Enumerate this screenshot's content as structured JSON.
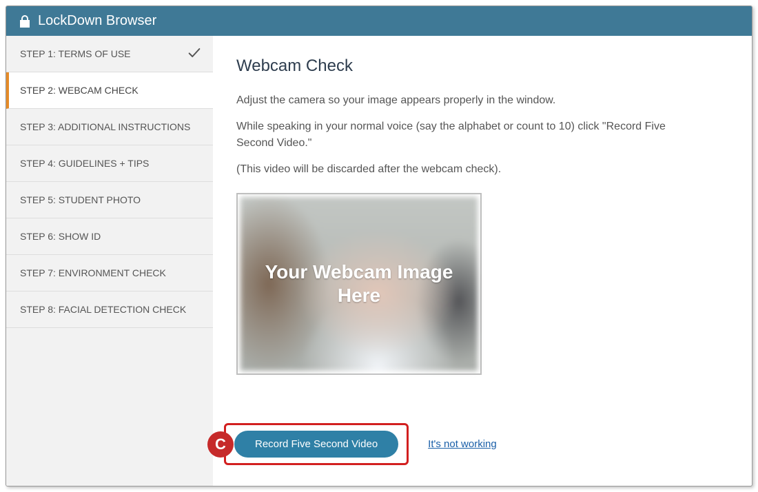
{
  "app_title": "LockDown Browser",
  "sidebar": {
    "steps": [
      {
        "label": "STEP 1: TERMS OF USE",
        "completed": true,
        "active": false
      },
      {
        "label": "STEP 2: WEBCAM CHECK",
        "completed": false,
        "active": true
      },
      {
        "label": "STEP 3: ADDITIONAL INSTRUCTIONS",
        "completed": false,
        "active": false
      },
      {
        "label": "STEP 4: GUIDELINES + TIPS",
        "completed": false,
        "active": false
      },
      {
        "label": "STEP 5: STUDENT PHOTO",
        "completed": false,
        "active": false
      },
      {
        "label": "STEP 6: SHOW ID",
        "completed": false,
        "active": false
      },
      {
        "label": "STEP 7: ENVIRONMENT CHECK",
        "completed": false,
        "active": false
      },
      {
        "label": "STEP 8: FACIAL DETECTION CHECK",
        "completed": false,
        "active": false
      }
    ]
  },
  "main": {
    "title": "Webcam Check",
    "paragraph1": "Adjust the camera so your image appears properly in the window.",
    "paragraph2": "While speaking in your normal voice (say the alphabet or count to 10) click \"Record Five Second Video.\"",
    "paragraph3": "(This video will be discarded after the webcam check).",
    "webcam_placeholder_text": "Your Webcam Image Here",
    "record_button_label": "Record Five Second Video",
    "not_working_link_label": "It's not working",
    "callout_letter": "C"
  },
  "colors": {
    "header_bg": "#3f7996",
    "accent_orange": "#e58b28",
    "button_bg": "#2f80a6",
    "callout_red": "#d21f1f"
  }
}
